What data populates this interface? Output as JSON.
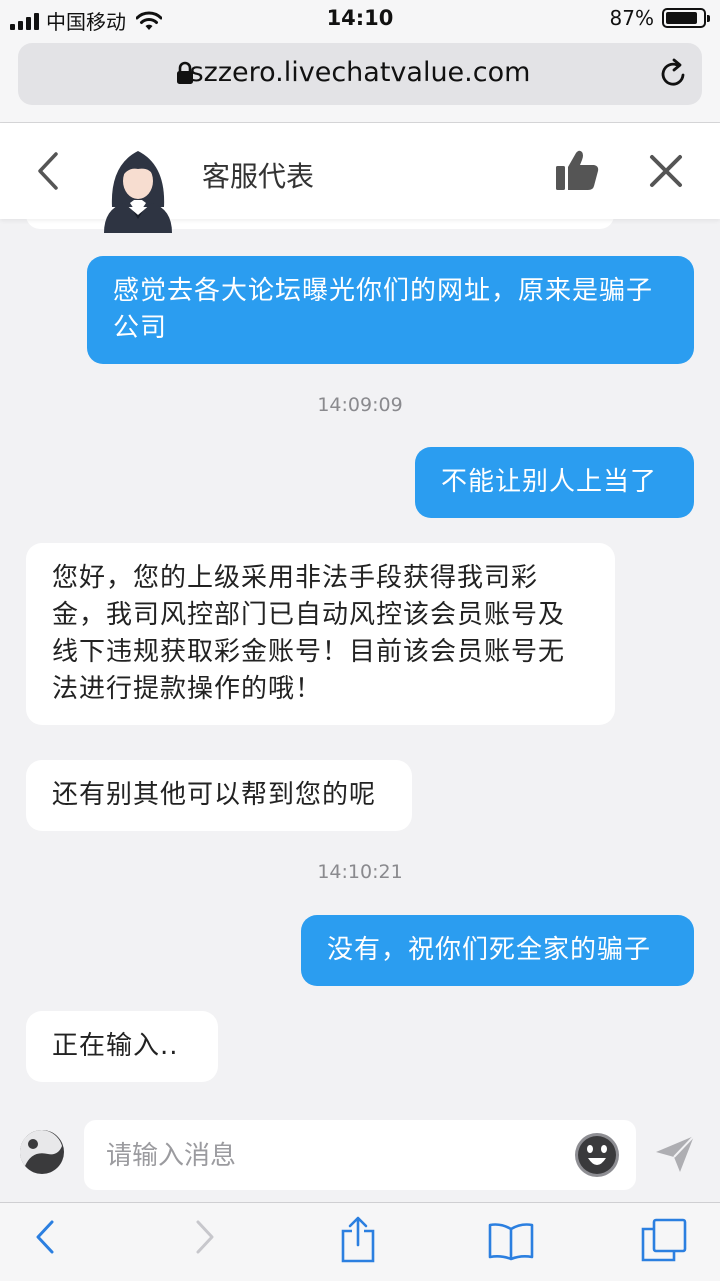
{
  "status_bar": {
    "carrier": "中国移动",
    "time": "14:10",
    "battery": "87%",
    "battery_level": 0.87
  },
  "browser": {
    "url": "szzero.livechatvalue.com"
  },
  "chat_header": {
    "agent_name": "客服代表"
  },
  "messages": [
    {
      "type": "out",
      "text": "感觉去各大论坛曝光你们的网址，原来是骗子公司"
    },
    {
      "type": "timestamp",
      "text": "14:09:09"
    },
    {
      "type": "out",
      "text": "不能让别人上当了"
    },
    {
      "type": "in",
      "text": "您好，您的上级采用非法手段获得我司彩金，我司风控部门已自动风控该会员账号及线下违规获取彩金账号！目前该会员账号无法进行提款操作的哦！"
    },
    {
      "type": "in",
      "text": "还有别其他可以帮到您的呢"
    },
    {
      "type": "timestamp",
      "text": "14:10:21"
    },
    {
      "type": "out",
      "text": "没有，祝你们死全家的骗子"
    },
    {
      "type": "in",
      "text": "正在输入.."
    }
  ],
  "composer": {
    "placeholder": "请输入消息"
  }
}
